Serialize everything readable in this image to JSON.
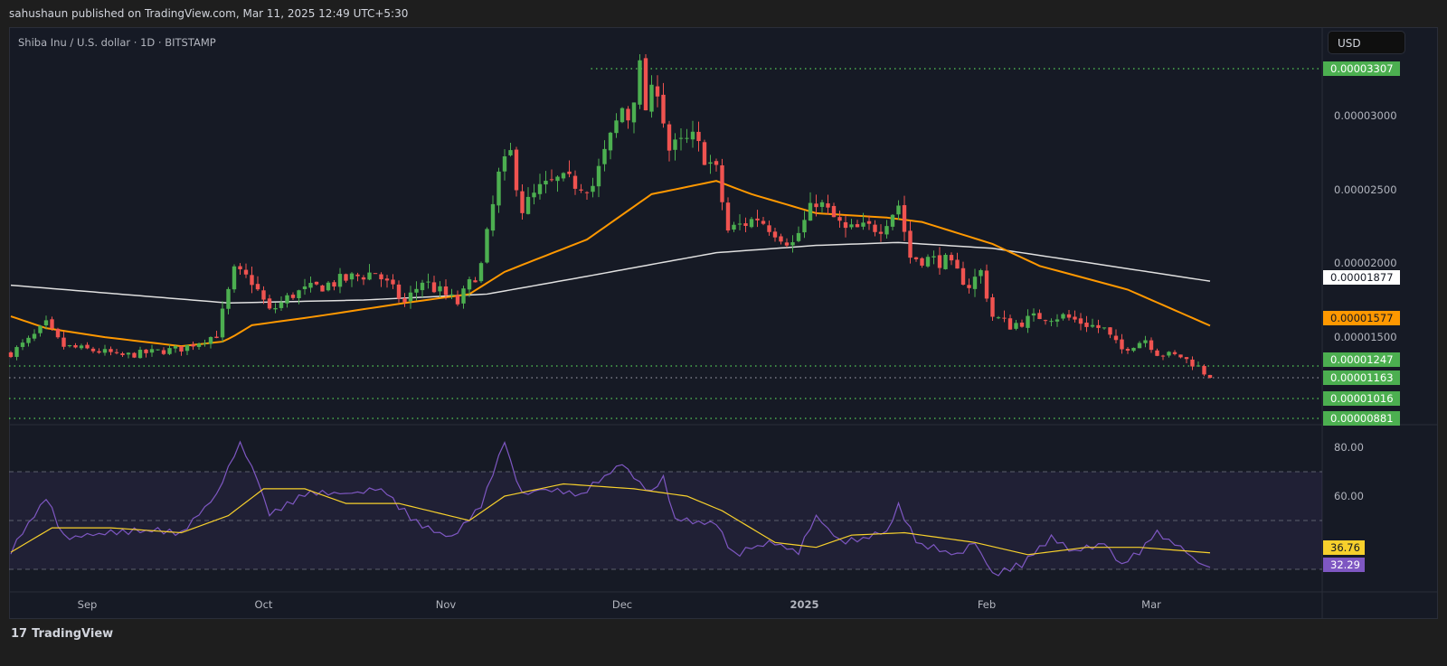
{
  "header": {
    "published": "sahushaun published on TradingView.com, Mar 11, 2025 12:49 UTC+5:30"
  },
  "symbol": {
    "title": "Shiba Inu / U.S. dollar · 1D · BITSTAMP"
  },
  "currency_button": "USD",
  "price_axis": {
    "ticks": [
      {
        "value": 30.0,
        "label": "0.00003000"
      },
      {
        "value": 25.0,
        "label": "0.00002500"
      },
      {
        "value": 20.0,
        "label": "0.00002000"
      },
      {
        "value": 15.0,
        "label": "0.00001500"
      }
    ]
  },
  "price_badges": [
    {
      "value": 33.07,
      "label": "0.00003307",
      "bg": "#4caf50",
      "fg": "#ffffff"
    },
    {
      "value": 18.77,
      "label": "0.00001877",
      "bg": "#ffffff",
      "fg": "#131722"
    },
    {
      "value": 15.77,
      "label": "0.00001577",
      "bg": "#ff9800",
      "fg": "#131722"
    },
    {
      "value": 12.47,
      "label": "0.00001247",
      "bg": "#4caf50",
      "fg": "#ffffff"
    },
    {
      "value": 11.63,
      "label": "0.00001163",
      "bg": "#4caf50",
      "fg": "#ffffff"
    },
    {
      "value": 10.16,
      "label": "0.00001016",
      "bg": "#4caf50",
      "fg": "#ffffff"
    },
    {
      "value": 8.81,
      "label": "0.00000881",
      "bg": "#4caf50",
      "fg": "#ffffff"
    }
  ],
  "rsi_axis": {
    "ticks": [
      {
        "value": 80,
        "label": "80.00"
      },
      {
        "value": 60,
        "label": "60.00"
      }
    ]
  },
  "rsi_badges": [
    {
      "value": 36.76,
      "label": "36.76",
      "bg": "#f7d02c",
      "fg": "#131722"
    },
    {
      "value": 32.29,
      "label": "32.29",
      "bg": "#7e57c2",
      "fg": "#ffffff"
    }
  ],
  "time_axis": [
    {
      "day": 13,
      "label": "Sep"
    },
    {
      "day": 43,
      "label": "Oct"
    },
    {
      "day": 74,
      "label": "Nov"
    },
    {
      "day": 104,
      "label": "Dec"
    },
    {
      "day": 135,
      "label": "2025"
    },
    {
      "day": 166,
      "label": "Feb"
    },
    {
      "day": 194,
      "label": "Mar"
    }
  ],
  "footer": {
    "logo_text": "TradingView"
  },
  "colors": {
    "up": "#4caf50",
    "down": "#f05350",
    "ma50": "#ff9800",
    "ma200": "#e0e0e0",
    "rsi": "#7e57c2",
    "rsi_ma": "#f7d02c",
    "level": "#4caf50"
  },
  "chart_data": {
    "type": "candlestick",
    "title": "Shiba Inu / U.S. dollar · 1D · BITSTAMP",
    "unit": "1e-6 USD",
    "x_unit": "day index (daily candles, Sep..Mar 11)",
    "close_anchors": [
      [
        0,
        13.6
      ],
      [
        6,
        15.8
      ],
      [
        9,
        14.2
      ],
      [
        17,
        13.6
      ],
      [
        18,
        13.3
      ],
      [
        29,
        14.0
      ],
      [
        35,
        15.2
      ],
      [
        38,
        19.4
      ],
      [
        41,
        18.8
      ],
      [
        44,
        16.7
      ],
      [
        48,
        17.9
      ],
      [
        56,
        18.8
      ],
      [
        62,
        19.4
      ],
      [
        67,
        17.3
      ],
      [
        70,
        18.8
      ],
      [
        76,
        17.3
      ],
      [
        80,
        19.8
      ],
      [
        83,
        25.9
      ],
      [
        85,
        27.4
      ],
      [
        87,
        23.7
      ],
      [
        90,
        25.0
      ],
      [
        93,
        25.6
      ],
      [
        99,
        25.3
      ],
      [
        104,
        30.5
      ],
      [
        105,
        29.9
      ],
      [
        107,
        33.0
      ],
      [
        108,
        30.5
      ],
      [
        110,
        32.0
      ],
      [
        112,
        27.7
      ],
      [
        116,
        28.4
      ],
      [
        120,
        26.2
      ],
      [
        122,
        22.2
      ],
      [
        127,
        23.1
      ],
      [
        133,
        21.3
      ],
      [
        137,
        24.3
      ],
      [
        142,
        22.2
      ],
      [
        148,
        22.5
      ],
      [
        151,
        24.0
      ],
      [
        153,
        20.4
      ],
      [
        159,
        20.1
      ],
      [
        163,
        18.5
      ],
      [
        165,
        19.4
      ],
      [
        167,
        16.4
      ],
      [
        170,
        15.8
      ],
      [
        175,
        16.4
      ],
      [
        179,
        16.4
      ],
      [
        186,
        15.5
      ],
      [
        189,
        13.9
      ],
      [
        193,
        14.8
      ],
      [
        195,
        13.6
      ],
      [
        199,
        13.3
      ],
      [
        202,
        12.4
      ],
      [
        204,
        11.63
      ]
    ],
    "ma50_anchors": [
      [
        0,
        16.4
      ],
      [
        6,
        15.6
      ],
      [
        29,
        14.2
      ],
      [
        36,
        14.6
      ],
      [
        41,
        15.8
      ],
      [
        52,
        16.4
      ],
      [
        67,
        17.3
      ],
      [
        78,
        17.9
      ],
      [
        84,
        19.4
      ],
      [
        98,
        21.6
      ],
      [
        109,
        24.7
      ],
      [
        120,
        25.6
      ],
      [
        126,
        24.7
      ],
      [
        137,
        23.4
      ],
      [
        149,
        23.1
      ],
      [
        155,
        22.8
      ],
      [
        167,
        21.3
      ],
      [
        175,
        19.8
      ],
      [
        190,
        18.2
      ],
      [
        204,
        15.77
      ]
    ],
    "ma200_anchors": [
      [
        0,
        18.5
      ],
      [
        37,
        17.3
      ],
      [
        60,
        17.5
      ],
      [
        81,
        17.9
      ],
      [
        98,
        19.1
      ],
      [
        120,
        20.7
      ],
      [
        137,
        21.2
      ],
      [
        151,
        21.4
      ],
      [
        167,
        21.0
      ],
      [
        204,
        18.77
      ]
    ],
    "levels": [
      {
        "value": 33.07,
        "from_day": 99
      },
      {
        "value": 12.47,
        "from_day": 0
      },
      {
        "value": 11.63,
        "from_day": 0
      },
      {
        "value": 10.16,
        "from_day": 0
      },
      {
        "value": 8.81,
        "from_day": 0
      }
    ],
    "ylim": [
      8.5,
      34
    ],
    "rsi": {
      "levels": [
        70,
        50,
        30
      ],
      "rsi_anchors": [
        [
          0,
          37
        ],
        [
          6,
          60
        ],
        [
          9,
          43
        ],
        [
          17,
          45
        ],
        [
          23,
          46
        ],
        [
          29,
          45
        ],
        [
          35,
          61
        ],
        [
          39,
          82
        ],
        [
          42,
          67
        ],
        [
          44,
          52
        ],
        [
          50,
          61
        ],
        [
          57,
          61
        ],
        [
          63,
          63
        ],
        [
          69,
          49
        ],
        [
          75,
          43
        ],
        [
          80,
          56
        ],
        [
          84,
          82
        ],
        [
          87,
          60
        ],
        [
          90,
          63
        ],
        [
          97,
          61
        ],
        [
          104,
          73
        ],
        [
          109,
          61
        ],
        [
          111,
          67
        ],
        [
          113,
          50
        ],
        [
          120,
          49
        ],
        [
          123,
          36
        ],
        [
          129,
          41
        ],
        [
          134,
          37
        ],
        [
          137,
          52
        ],
        [
          141,
          41
        ],
        [
          149,
          45
        ],
        [
          151,
          56
        ],
        [
          154,
          41
        ],
        [
          161,
          36
        ],
        [
          164,
          41
        ],
        [
          167,
          28
        ],
        [
          172,
          32
        ],
        [
          177,
          43
        ],
        [
          181,
          37
        ],
        [
          186,
          41
        ],
        [
          189,
          32
        ],
        [
          192,
          37
        ],
        [
          195,
          45
        ],
        [
          198,
          41
        ],
        [
          203,
          31
        ],
        [
          204,
          32.29
        ]
      ],
      "ma_anchors": [
        [
          0,
          37
        ],
        [
          7,
          47
        ],
        [
          17,
          47
        ],
        [
          29,
          45
        ],
        [
          37,
          52
        ],
        [
          43,
          63
        ],
        [
          50,
          63
        ],
        [
          57,
          57
        ],
        [
          66,
          57
        ],
        [
          78,
          50
        ],
        [
          84,
          60
        ],
        [
          94,
          65
        ],
        [
          106,
          63
        ],
        [
          115,
          60
        ],
        [
          121,
          54
        ],
        [
          130,
          41
        ],
        [
          137,
          39
        ],
        [
          143,
          44
        ],
        [
          152,
          45
        ],
        [
          164,
          41
        ],
        [
          173,
          36
        ],
        [
          183,
          39
        ],
        [
          192,
          39
        ],
        [
          204,
          36.76
        ]
      ]
    }
  }
}
